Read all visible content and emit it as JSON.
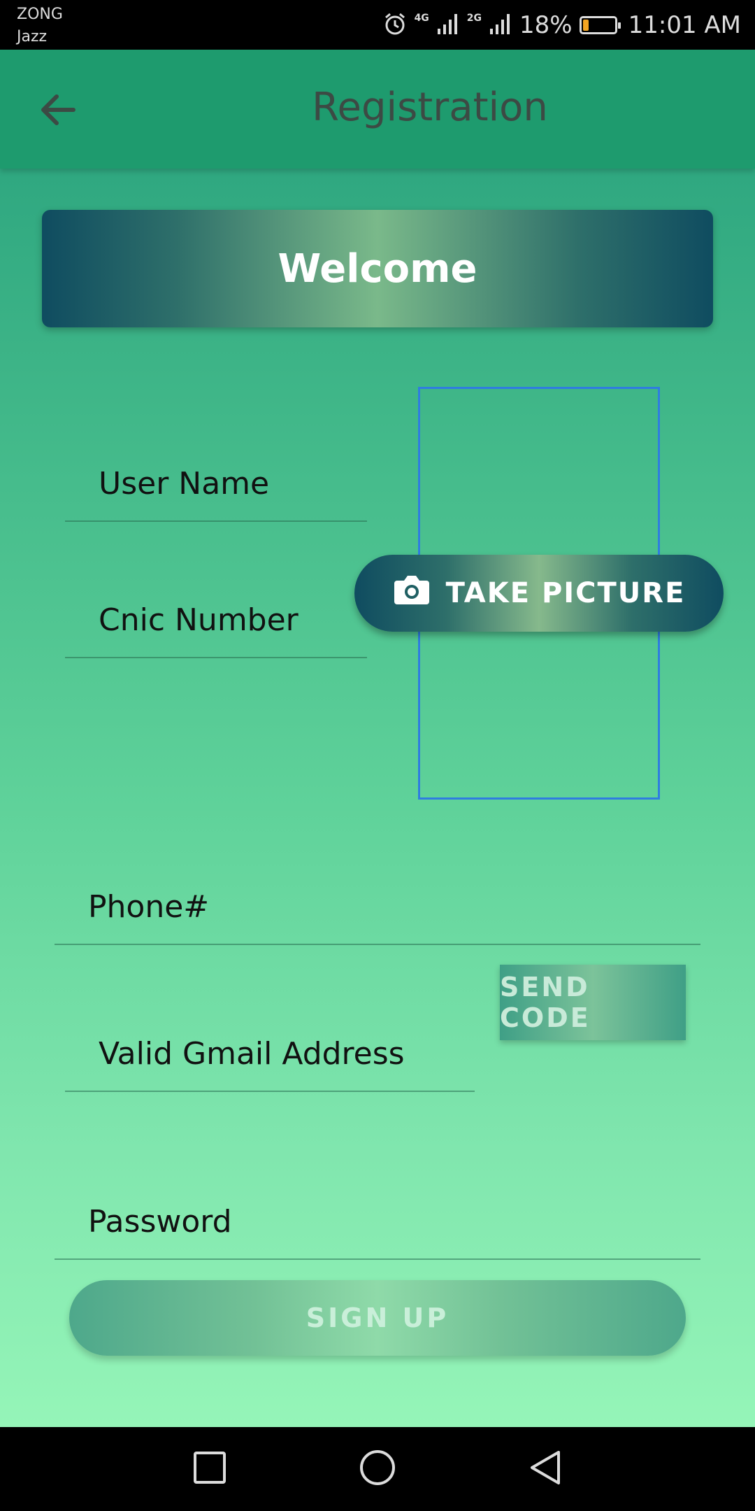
{
  "status_bar": {
    "carrier_primary": "ZONG",
    "carrier_secondary": "Jazz",
    "network_1": "4G",
    "network_2": "2G",
    "battery_percent": "18%",
    "battery_level": 0.18,
    "time": "11:01 AM",
    "icons": [
      "alarm-icon",
      "signal-icon",
      "signal-icon",
      "battery-icon"
    ]
  },
  "app_bar": {
    "title": "Registration",
    "back_icon": "arrow-left-icon"
  },
  "welcome_banner": {
    "text": "Welcome"
  },
  "form": {
    "user_name_placeholder": "User Name",
    "cnic_placeholder": "Cnic Number",
    "phone_placeholder": "Phone#",
    "gmail_placeholder": "Valid Gmail Address",
    "password_placeholder": "Password"
  },
  "buttons": {
    "take_picture": "TAKE PICTURE",
    "take_picture_icon": "camera-icon",
    "send_code": "SEND CODE",
    "sign_up": "SIGN UP"
  },
  "nav_bar": {
    "icons": [
      "recents-square-icon",
      "home-circle-icon",
      "back-triangle-icon"
    ]
  },
  "colors": {
    "app_bar": "#1e9b6e",
    "title_text": "#3c4a44",
    "gradient_dark": "#0f4c60",
    "gradient_light": "#7ab98a",
    "photo_frame": "#2f7de0",
    "battery_fill": "#f5a623"
  }
}
